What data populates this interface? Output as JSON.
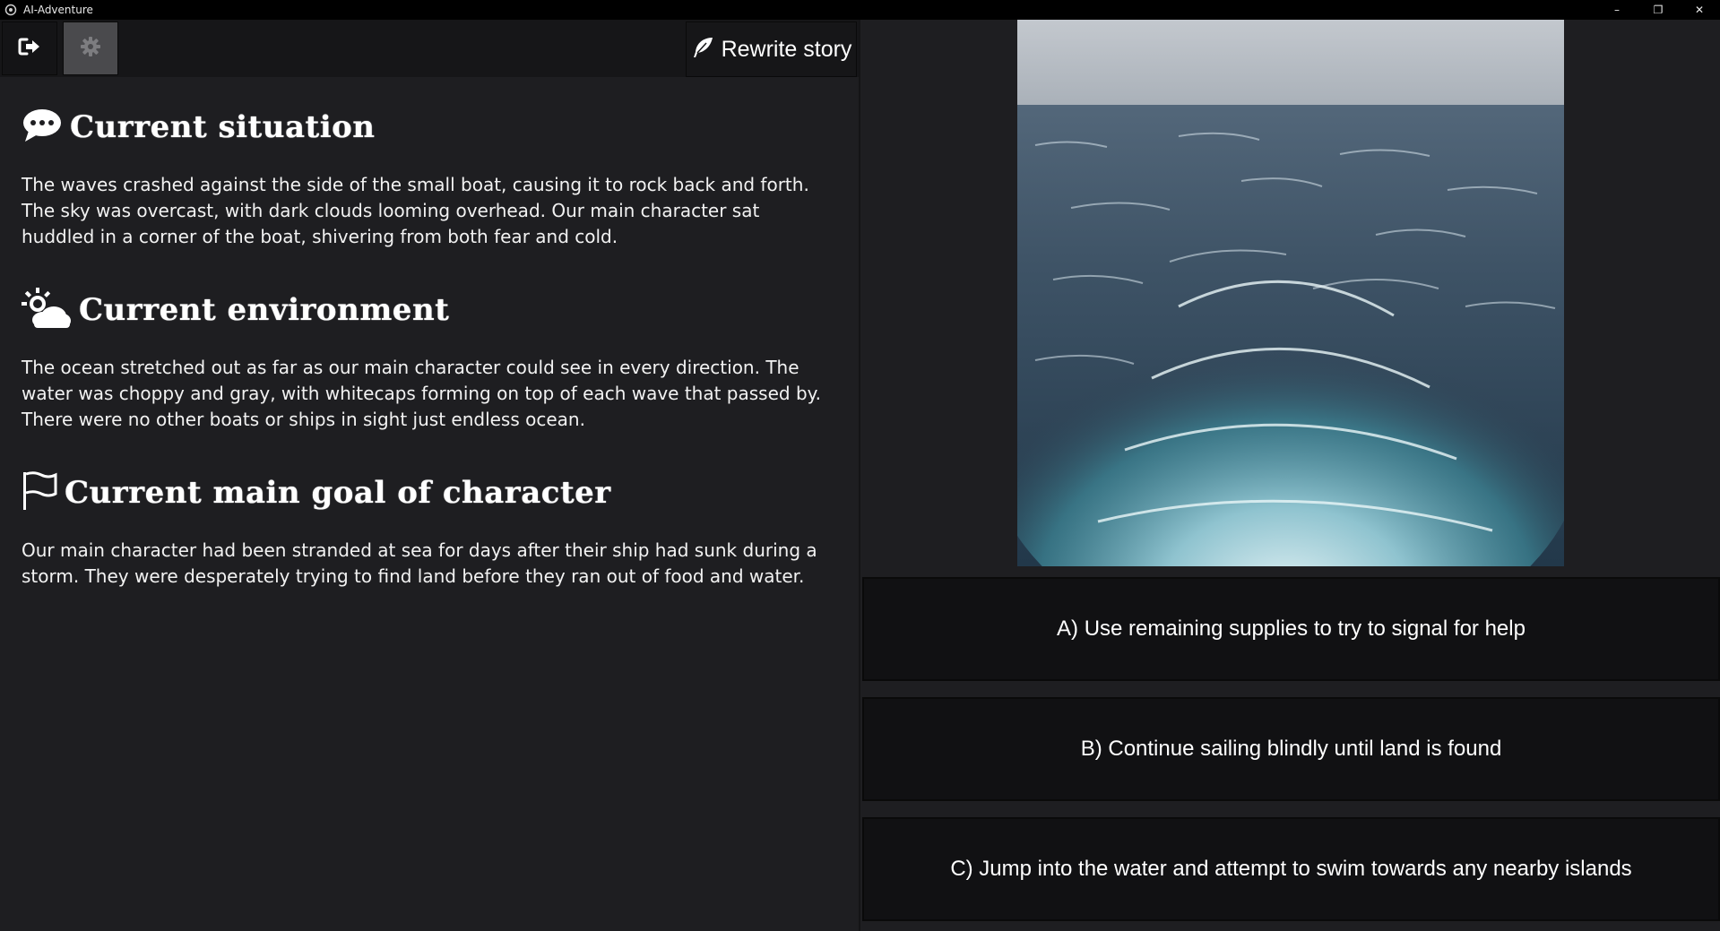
{
  "window": {
    "title": "AI-Adventure",
    "controls": {
      "minimize": "–",
      "restore": "❐",
      "close": "✕"
    }
  },
  "toolbar": {
    "exit_icon": "exit-icon",
    "settings_icon": "gear-icon",
    "rewrite_icon": "feather-icon",
    "rewrite_label": "Rewrite story"
  },
  "sections": {
    "situation": {
      "icon": "speech-bubble-icon",
      "title": "Current situation",
      "body": "The waves crashed against the side of the small boat, causing it to rock back and forth. The sky was overcast, with dark clouds looming overhead. Our main character sat huddled in a corner of the boat, shivering from both fear and cold."
    },
    "environment": {
      "icon": "sun-cloud-icon",
      "title": "Current environment",
      "body": "The ocean stretched out as far as our main character could see in every direction. The water was choppy and gray, with whitecaps forming on top of each wave that passed by. There were no other boats or ships in sight just endless ocean."
    },
    "goal": {
      "icon": "flag-icon",
      "title": "Current main goal of character",
      "body": "Our main character had been stranded at sea for days after their ship had sunk during a storm. They were desperately trying to find land before they ran out of food and water."
    }
  },
  "scene": {
    "image": "stormy-ocean-image",
    "colors": {
      "sky": "#c7ccd1",
      "sea_dark": "#2c3d4e",
      "foam": "#cfe3ea",
      "teal": "#3f8a9a"
    }
  },
  "choices": [
    {
      "label": "A) Use remaining supplies to try to signal for help"
    },
    {
      "label": "B) Continue sailing blindly until land is found"
    },
    {
      "label": "C) Jump into the water and attempt to swim towards any nearby islands"
    }
  ],
  "colors": {
    "background": "#1e1e21",
    "toolbar": "#161618",
    "button_dark": "#111113",
    "settings_button": "#4a4a4d",
    "text": "#ffffff"
  }
}
